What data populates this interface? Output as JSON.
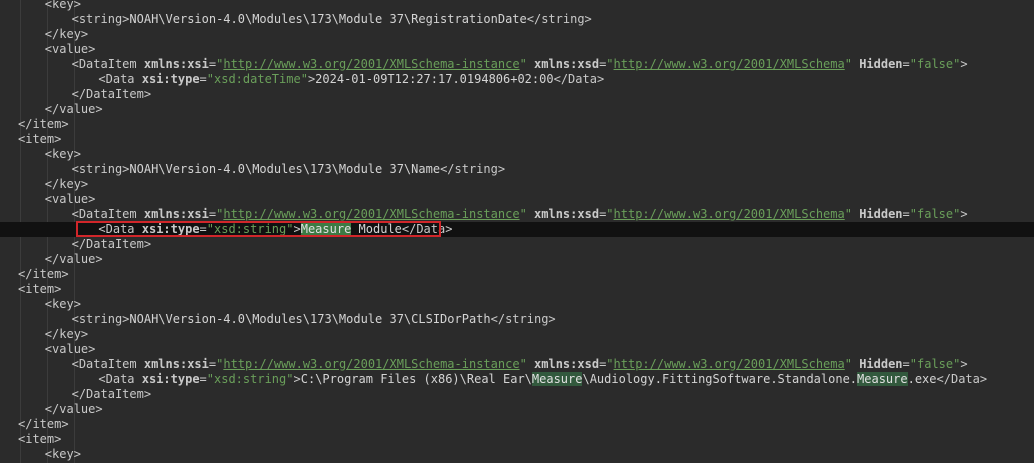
{
  "lines": [
    {
      "indent": 2,
      "segments": [
        {
          "k": "tag",
          "t": "<key>"
        }
      ]
    },
    {
      "indent": 3,
      "segments": [
        {
          "k": "tag",
          "t": "<string>"
        },
        {
          "k": "txt",
          "t": "NOAH\\Version-4.0\\Modules\\173\\Module 37\\RegistrationDate"
        },
        {
          "k": "tag",
          "t": "</string>"
        }
      ]
    },
    {
      "indent": 2,
      "segments": [
        {
          "k": "tag",
          "t": "</key>"
        }
      ]
    },
    {
      "indent": 2,
      "segments": [
        {
          "k": "tag",
          "t": "<value>"
        }
      ]
    },
    {
      "indent": 3,
      "segments": [
        {
          "k": "tag",
          "t": "<DataItem "
        },
        {
          "k": "attr",
          "t": "xmlns:xsi"
        },
        {
          "k": "tag",
          "t": "="
        },
        {
          "k": "val",
          "t": "\""
        },
        {
          "k": "url",
          "t": "http://www.w3.org/2001/XMLSchema-instance"
        },
        {
          "k": "val",
          "t": "\""
        },
        {
          "k": "tag",
          "t": " "
        },
        {
          "k": "attr",
          "t": "xmlns:xsd"
        },
        {
          "k": "tag",
          "t": "="
        },
        {
          "k": "val",
          "t": "\""
        },
        {
          "k": "url",
          "t": "http://www.w3.org/2001/XMLSchema"
        },
        {
          "k": "val",
          "t": "\""
        },
        {
          "k": "tag",
          "t": " "
        },
        {
          "k": "attr",
          "t": "Hidden"
        },
        {
          "k": "tag",
          "t": "="
        },
        {
          "k": "val",
          "t": "\"false\""
        },
        {
          "k": "tag",
          "t": ">"
        }
      ]
    },
    {
      "indent": 4,
      "segments": [
        {
          "k": "tag",
          "t": "<Data "
        },
        {
          "k": "attr",
          "t": "xsi:type"
        },
        {
          "k": "tag",
          "t": "="
        },
        {
          "k": "val",
          "t": "\"xsd:dateTime\""
        },
        {
          "k": "tag",
          "t": ">"
        },
        {
          "k": "txt",
          "t": "2024-01-09T12:27:17.0194806+02:00"
        },
        {
          "k": "tag",
          "t": "</Data>"
        }
      ]
    },
    {
      "indent": 3,
      "segments": [
        {
          "k": "tag",
          "t": "</DataItem>"
        }
      ]
    },
    {
      "indent": 2,
      "segments": [
        {
          "k": "tag",
          "t": "</value>"
        }
      ]
    },
    {
      "indent": 1,
      "segments": [
        {
          "k": "tag",
          "t": "</item>"
        }
      ]
    },
    {
      "indent": 1,
      "segments": [
        {
          "k": "tag",
          "t": "<item>"
        }
      ]
    },
    {
      "indent": 2,
      "segments": [
        {
          "k": "tag",
          "t": "<key>"
        }
      ]
    },
    {
      "indent": 3,
      "segments": [
        {
          "k": "tag",
          "t": "<string>"
        },
        {
          "k": "txt",
          "t": "NOAH\\Version-4.0\\Modules\\173\\Module 37\\Name"
        },
        {
          "k": "tag",
          "t": "</string>"
        }
      ]
    },
    {
      "indent": 2,
      "segments": [
        {
          "k": "tag",
          "t": "</key>"
        }
      ]
    },
    {
      "indent": 2,
      "segments": [
        {
          "k": "tag",
          "t": "<value>"
        }
      ]
    },
    {
      "indent": 3,
      "segments": [
        {
          "k": "tag",
          "t": "<DataItem "
        },
        {
          "k": "attr",
          "t": "xmlns:xsi"
        },
        {
          "k": "tag",
          "t": "="
        },
        {
          "k": "val",
          "t": "\""
        },
        {
          "k": "url",
          "t": "http://www.w3.org/2001/XMLSchema-instance"
        },
        {
          "k": "val",
          "t": "\""
        },
        {
          "k": "tag",
          "t": " "
        },
        {
          "k": "attr",
          "t": "xmlns:xsd"
        },
        {
          "k": "tag",
          "t": "="
        },
        {
          "k": "val",
          "t": "\""
        },
        {
          "k": "url",
          "t": "http://www.w3.org/2001/XMLSchema"
        },
        {
          "k": "val",
          "t": "\""
        },
        {
          "k": "tag",
          "t": " "
        },
        {
          "k": "attr",
          "t": "Hidden"
        },
        {
          "k": "tag",
          "t": "="
        },
        {
          "k": "val",
          "t": "\"false\""
        },
        {
          "k": "tag",
          "t": ">"
        }
      ]
    },
    {
      "indent": 4,
      "current": true,
      "segments": [
        {
          "k": "tag",
          "t": "<Data "
        },
        {
          "k": "attr",
          "t": "xsi:type"
        },
        {
          "k": "tag",
          "t": "="
        },
        {
          "k": "val",
          "t": "\"xsd:string\""
        },
        {
          "k": "tag",
          "t": ">"
        },
        {
          "k": "hl-sel",
          "t": "Measure"
        },
        {
          "k": "txt",
          "t": " Module"
        },
        {
          "k": "tag",
          "t": "</Data>"
        }
      ]
    },
    {
      "indent": 3,
      "segments": [
        {
          "k": "tag",
          "t": "</DataItem>"
        }
      ]
    },
    {
      "indent": 2,
      "segments": [
        {
          "k": "tag",
          "t": "</value>"
        }
      ]
    },
    {
      "indent": 1,
      "segments": [
        {
          "k": "tag",
          "t": "</item>"
        }
      ]
    },
    {
      "indent": 1,
      "segments": [
        {
          "k": "tag",
          "t": "<item>"
        }
      ]
    },
    {
      "indent": 2,
      "segments": [
        {
          "k": "tag",
          "t": "<key>"
        }
      ]
    },
    {
      "indent": 3,
      "segments": [
        {
          "k": "tag",
          "t": "<string>"
        },
        {
          "k": "txt",
          "t": "NOAH\\Version-4.0\\Modules\\173\\Module 37\\CLSIDorPath"
        },
        {
          "k": "tag",
          "t": "</string>"
        }
      ]
    },
    {
      "indent": 2,
      "segments": [
        {
          "k": "tag",
          "t": "</key>"
        }
      ]
    },
    {
      "indent": 2,
      "segments": [
        {
          "k": "tag",
          "t": "<value>"
        }
      ]
    },
    {
      "indent": 3,
      "segments": [
        {
          "k": "tag",
          "t": "<DataItem "
        },
        {
          "k": "attr",
          "t": "xmlns:xsi"
        },
        {
          "k": "tag",
          "t": "="
        },
        {
          "k": "val",
          "t": "\""
        },
        {
          "k": "url",
          "t": "http://www.w3.org/2001/XMLSchema-instance"
        },
        {
          "k": "val",
          "t": "\""
        },
        {
          "k": "tag",
          "t": " "
        },
        {
          "k": "attr",
          "t": "xmlns:xsd"
        },
        {
          "k": "tag",
          "t": "="
        },
        {
          "k": "val",
          "t": "\""
        },
        {
          "k": "url",
          "t": "http://www.w3.org/2001/XMLSchema"
        },
        {
          "k": "val",
          "t": "\""
        },
        {
          "k": "tag",
          "t": " "
        },
        {
          "k": "attr",
          "t": "Hidden"
        },
        {
          "k": "tag",
          "t": "="
        },
        {
          "k": "val",
          "t": "\"false\""
        },
        {
          "k": "tag",
          "t": ">"
        }
      ]
    },
    {
      "indent": 4,
      "segments": [
        {
          "k": "tag",
          "t": "<Data "
        },
        {
          "k": "attr",
          "t": "xsi:type"
        },
        {
          "k": "tag",
          "t": "="
        },
        {
          "k": "val",
          "t": "\"xsd:string\""
        },
        {
          "k": "tag",
          "t": ">"
        },
        {
          "k": "txt",
          "t": "C:\\Program Files (x86)\\Real Ear\\"
        },
        {
          "k": "hl",
          "t": "Measure"
        },
        {
          "k": "txt",
          "t": "\\Audiology.FittingSoftware.Standalone."
        },
        {
          "k": "hl",
          "t": "Measure"
        },
        {
          "k": "txt",
          "t": ".exe"
        },
        {
          "k": "tag",
          "t": "</Data>"
        }
      ]
    },
    {
      "indent": 3,
      "segments": [
        {
          "k": "tag",
          "t": "</DataItem>"
        }
      ]
    },
    {
      "indent": 2,
      "segments": [
        {
          "k": "tag",
          "t": "</value>"
        }
      ]
    },
    {
      "indent": 1,
      "segments": [
        {
          "k": "tag",
          "t": "</item>"
        }
      ]
    },
    {
      "indent": 1,
      "segments": [
        {
          "k": "tag",
          "t": "<item>"
        }
      ]
    },
    {
      "indent": 2,
      "segments": [
        {
          "k": "tag",
          "t": "<key>"
        }
      ]
    }
  ]
}
